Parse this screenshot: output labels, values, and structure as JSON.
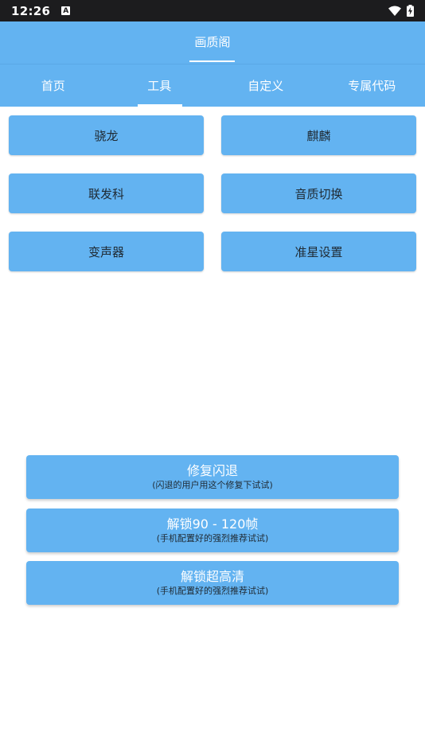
{
  "status_bar": {
    "time": "12:26",
    "notification_icon": "A",
    "icons": [
      "wifi-icon",
      "battery-charging-icon"
    ]
  },
  "app_bar": {
    "title": "画质阁"
  },
  "tabs": [
    {
      "label": "首页",
      "selected": false
    },
    {
      "label": "工具",
      "selected": true
    },
    {
      "label": "自定义",
      "selected": false
    },
    {
      "label": "专属代码",
      "selected": false
    }
  ],
  "tool_buttons": [
    {
      "label": "骁龙"
    },
    {
      "label": "麒麟"
    },
    {
      "label": "联发科"
    },
    {
      "label": "音质切换"
    },
    {
      "label": "变声器"
    },
    {
      "label": "准星设置"
    }
  ],
  "action_buttons": [
    {
      "title": "修复闪退",
      "subtitle": "(闪退的用户用这个修复下试试)"
    },
    {
      "title": "解锁90 - 120帧",
      "subtitle": "(手机配置好的强烈推荐试试)"
    },
    {
      "title": "解锁超高清",
      "subtitle": "(手机配置好的强烈推荐试试)"
    }
  ],
  "colors": {
    "primary": "#63b3f1",
    "status_bar": "#1c1c1e",
    "background": "#ffffff",
    "button_text": "#1f2a33"
  }
}
